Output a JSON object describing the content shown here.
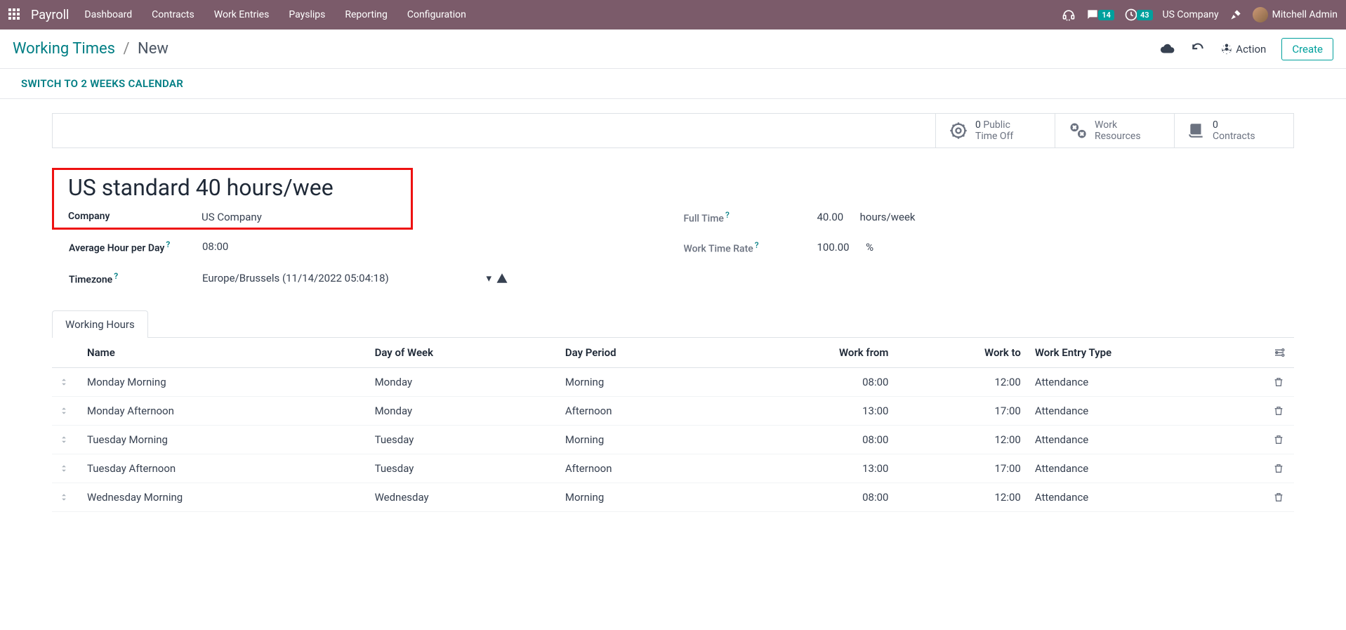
{
  "topbar": {
    "app": "Payroll",
    "menu": [
      "Dashboard",
      "Contracts",
      "Work Entries",
      "Payslips",
      "Reporting",
      "Configuration"
    ],
    "msg_badge": "14",
    "act_badge": "43",
    "company": "US Company",
    "user": "Mitchell Admin"
  },
  "breadcrumb": {
    "link": "Working Times",
    "current": "New"
  },
  "header_actions": {
    "action": "Action",
    "create": "Create"
  },
  "switch": "SWITCH TO 2 WEEKS CALENDAR",
  "stats": [
    {
      "count": "0",
      "label1": "Public",
      "label2": "Time Off"
    },
    {
      "count": "",
      "label1": "Work",
      "label2": "Resources"
    },
    {
      "count": "0",
      "label1": "",
      "label2": "Contracts"
    }
  ],
  "record": {
    "title": "US standard 40 hours/wee",
    "company_label": "Company",
    "company_value": "US Company",
    "avg_label": "Average Hour per Day",
    "avg_value": "08:00",
    "tz_label": "Timezone",
    "tz_value": "Europe/Brussels (11/14/2022 05:04:18)",
    "ft_label": "Full Time",
    "ft_value": "40.00",
    "ft_unit": "hours/week",
    "wtr_label": "Work Time Rate",
    "wtr_value": "100.00",
    "wtr_unit": "%"
  },
  "tabs": {
    "working_hours": "Working Hours"
  },
  "columns": {
    "name": "Name",
    "day": "Day of Week",
    "period": "Day Period",
    "from": "Work from",
    "to": "Work to",
    "type": "Work Entry Type"
  },
  "rows": [
    {
      "name": "Monday Morning",
      "day": "Monday",
      "period": "Morning",
      "from": "08:00",
      "to": "12:00",
      "type": "Attendance"
    },
    {
      "name": "Monday Afternoon",
      "day": "Monday",
      "period": "Afternoon",
      "from": "13:00",
      "to": "17:00",
      "type": "Attendance"
    },
    {
      "name": "Tuesday Morning",
      "day": "Tuesday",
      "period": "Morning",
      "from": "08:00",
      "to": "12:00",
      "type": "Attendance"
    },
    {
      "name": "Tuesday Afternoon",
      "day": "Tuesday",
      "period": "Afternoon",
      "from": "13:00",
      "to": "17:00",
      "type": "Attendance"
    },
    {
      "name": "Wednesday Morning",
      "day": "Wednesday",
      "period": "Morning",
      "from": "08:00",
      "to": "12:00",
      "type": "Attendance"
    }
  ]
}
